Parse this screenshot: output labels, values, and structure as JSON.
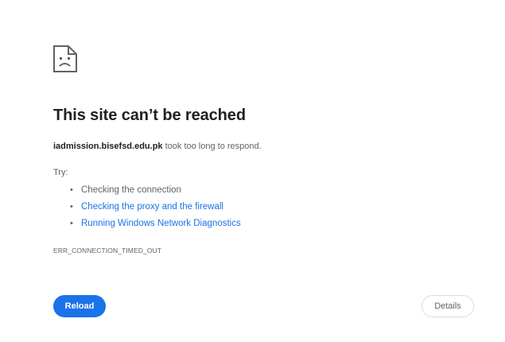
{
  "error_page": {
    "icon": "sad-page-icon",
    "title": "This site can’t be reached",
    "host": "iadmission.bisefsd.edu.pk",
    "message_suffix": " took too long to respond.",
    "try_label": "Try:",
    "suggestions": [
      {
        "text": "Checking the connection",
        "is_link": false
      },
      {
        "text": "Checking the proxy and the firewall",
        "is_link": true
      },
      {
        "text": "Running Windows Network Diagnostics",
        "is_link": true
      }
    ],
    "error_code": "ERR_CONNECTION_TIMED_OUT",
    "reload_label": "Reload",
    "details_label": "Details"
  },
  "colors": {
    "accent": "#1a73e8",
    "title_text": "#202124",
    "secondary_text": "#5f6368",
    "button_border": "#dadce0",
    "background": "#ffffff"
  }
}
